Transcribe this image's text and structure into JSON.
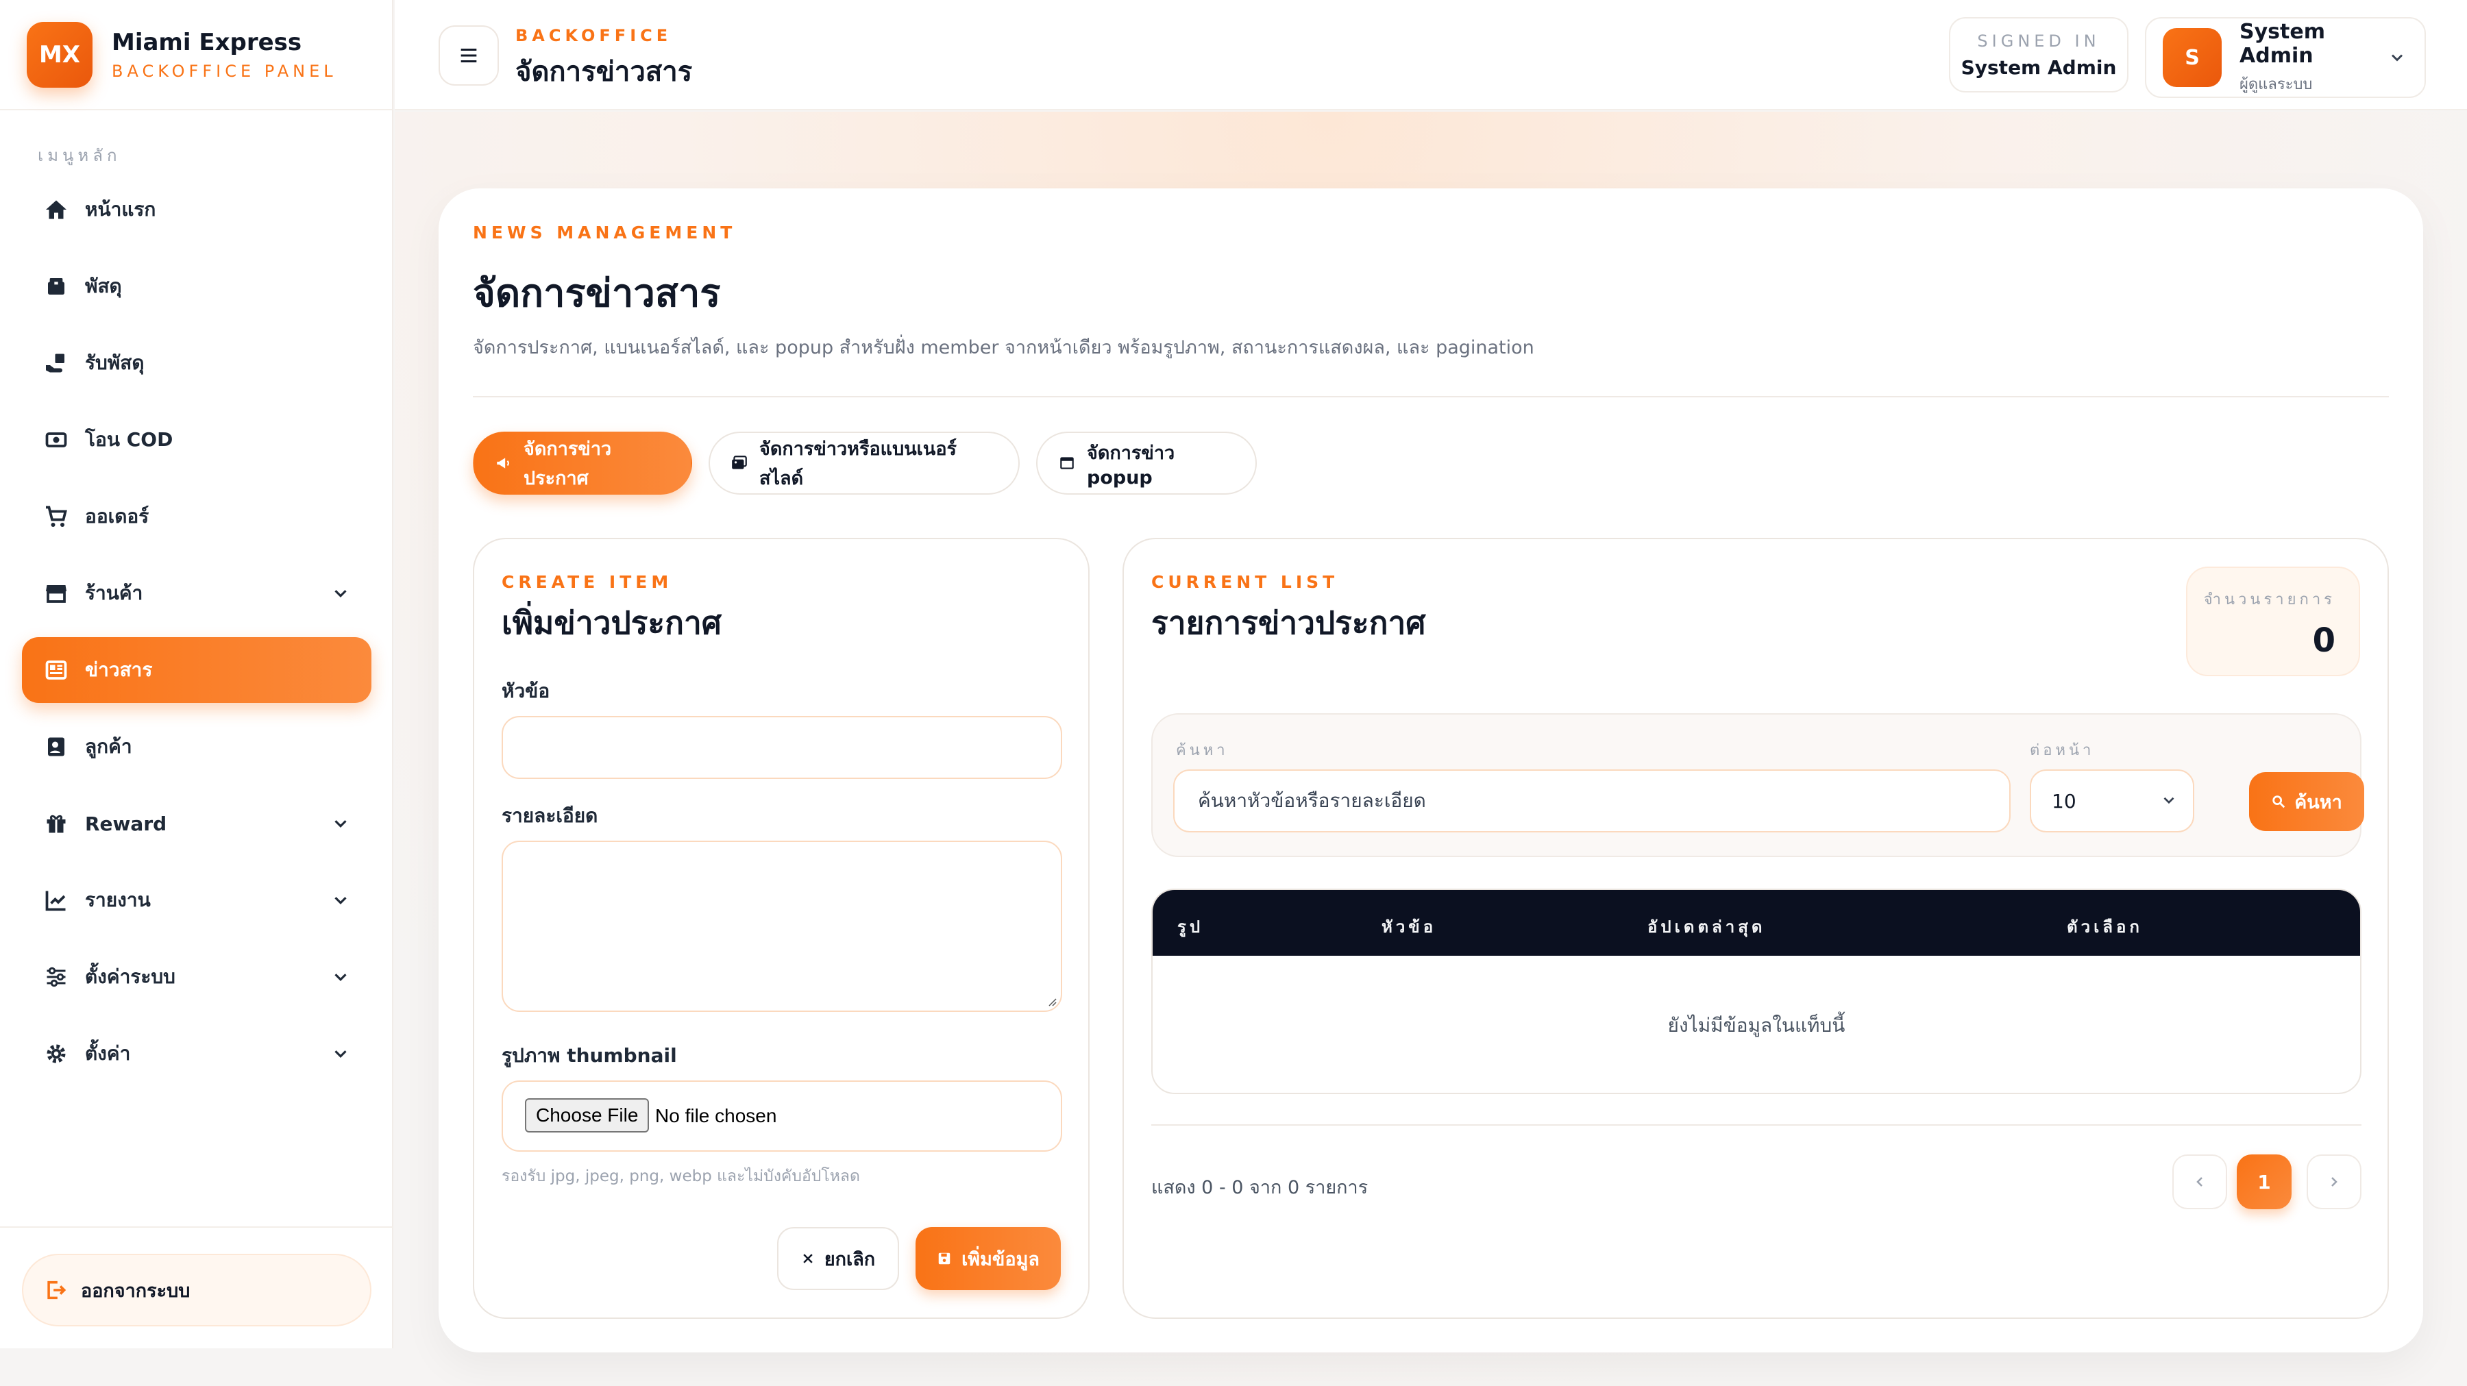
{
  "brand": {
    "logo_text": "MX",
    "name": "Miami Express",
    "subtitle": "BACKOFFICE PANEL"
  },
  "sidebar": {
    "heading": "เมนูหลัก",
    "items": [
      {
        "label": "หน้าแรก",
        "icon": "home-icon",
        "active": false,
        "expandable": false
      },
      {
        "label": "พัสดุ",
        "icon": "package-icon",
        "active": false,
        "expandable": false
      },
      {
        "label": "รับพัสดุ",
        "icon": "receive-parcel-icon",
        "active": false,
        "expandable": false
      },
      {
        "label": "โอน COD",
        "icon": "money-transfer-icon",
        "active": false,
        "expandable": false
      },
      {
        "label": "ออเดอร์",
        "icon": "cart-icon",
        "active": false,
        "expandable": false
      },
      {
        "label": "ร้านค้า",
        "icon": "store-icon",
        "active": false,
        "expandable": true
      },
      {
        "label": "ข่าวสาร",
        "icon": "news-icon",
        "active": true,
        "expandable": false
      },
      {
        "label": "ลูกค้า",
        "icon": "customer-icon",
        "active": false,
        "expandable": false
      },
      {
        "label": "Reward",
        "icon": "gift-icon",
        "active": false,
        "expandable": true
      },
      {
        "label": "รายงาน",
        "icon": "chart-line-icon",
        "active": false,
        "expandable": true
      },
      {
        "label": "ตั้งค่าระบบ",
        "icon": "sliders-icon",
        "active": false,
        "expandable": true
      },
      {
        "label": "ตั้งค่า",
        "icon": "gear-icon",
        "active": false,
        "expandable": true
      }
    ],
    "logout_label": "ออกจากระบบ"
  },
  "header": {
    "kicker": "BACKOFFICE",
    "title": "จัดการข่าวสาร",
    "signed_in_label": "SIGNED IN",
    "signed_in_user": "System Admin",
    "user_initial": "S",
    "user_name": "System Admin",
    "user_role": "ผู้ดูแลระบบ"
  },
  "page": {
    "kicker": "NEWS MANAGEMENT",
    "title": "จัดการข่าวสาร",
    "description": "จัดการประกาศ, แบนเนอร์สไลด์, และ popup สำหรับฝั่ง member จากหน้าเดียว พร้อมรูปภาพ, สถานะการแสดงผล, และ pagination",
    "tabs": [
      {
        "label": "จัดการข่าวประกาศ",
        "icon": "megaphone-icon",
        "active": true
      },
      {
        "label": "จัดการข่าวหรือแบนเนอร์สไลด์",
        "icon": "images-icon",
        "active": false
      },
      {
        "label": "จัดการข่าว popup",
        "icon": "window-icon",
        "active": false
      }
    ]
  },
  "create_form": {
    "kicker": "CREATE ITEM",
    "title": "เพิ่มข่าวประกาศ",
    "title_label": "หัวข้อ",
    "title_value": "",
    "detail_label": "รายละเอียด",
    "detail_value": "",
    "thumbnail_label": "รูปภาพ thumbnail",
    "file_button": "Choose File",
    "file_status": "No file chosen",
    "hint": "รองรับ jpg, jpeg, png, webp และไม่บังคับอัปโหลด",
    "cancel_label": "ยกเลิก",
    "submit_label": "เพิ่มข้อมูล"
  },
  "list": {
    "kicker": "CURRENT LIST",
    "title": "รายการข่าวประกาศ",
    "count_label": "จำนวนรายการ",
    "count_value": "0",
    "search_label": "ค้นหา",
    "search_placeholder": "ค้นหาหัวข้อหรือรายละเอียด",
    "per_page_label": "ต่อหน้า",
    "per_page_value": "10",
    "search_button": "ค้นหา",
    "columns": [
      "รูป",
      "หัวข้อ",
      "อัปเดตล่าสุด",
      "ตัวเลือก"
    ],
    "empty_text": "ยังไม่มีข้อมูลในแท็บนี้",
    "showing_text": "แสดง 0 - 0 จาก 0 รายการ",
    "current_page": "1"
  },
  "colors": {
    "accent": "#f97316",
    "table_header": "#0b1020"
  }
}
